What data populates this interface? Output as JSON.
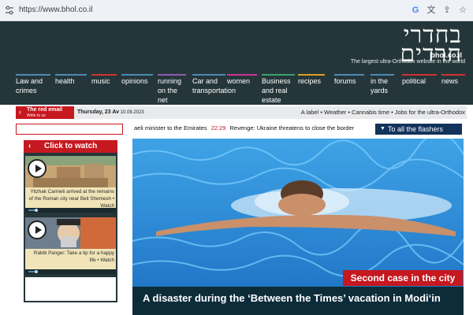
{
  "browser": {
    "url": "https://www.bhol.co.il",
    "icons": [
      "google-icon",
      "translate-icon",
      "share-icon",
      "bookmark-star-icon"
    ]
  },
  "header": {
    "logo_text": "בחדרי חרדים",
    "logo_domain": "bhol.co.il",
    "tagline": "The largest ultra-Orthodox website in the world"
  },
  "nav": {
    "items": [
      {
        "label": "Law and crimes"
      },
      {
        "label": "health"
      },
      {
        "label": "music"
      },
      {
        "label": "opinions"
      },
      {
        "label": "running on the net"
      },
      {
        "label": "Car and transportation"
      },
      {
        "label": "women"
      },
      {
        "label": "Business and real estate"
      },
      {
        "label": "recipes"
      },
      {
        "label": "forums"
      },
      {
        "label": "in the yards"
      },
      {
        "label": "political"
      },
      {
        "label": "news"
      }
    ]
  },
  "flash_row": {
    "email_title": "The red email",
    "email_sub": "Write to us",
    "date_day": "Thursday, 23 Av",
    "date_greg": "10.08.2023",
    "links": "A label • Weather • Cannabis time • Jobs for the ultra-Orthodox"
  },
  "ticker": {
    "left_text": "aeli minister to the Emirates",
    "time": "22:29",
    "right_text": "Revenge: Ukraine threatens to close the border"
  },
  "flashers_button": "To all the flashers",
  "video_panel": {
    "title": "Click to watch",
    "videos": [
      {
        "caption": "Yitzhak Carmeli arrived at the remains of the Roman city near Beit Shemesh • Watch",
        "progress": 0.1
      },
      {
        "caption": "Rabbi Panger: Take a tip for a happy life • Watch",
        "progress": 0.1
      }
    ]
  },
  "hero": {
    "badge": "Second case in the city",
    "title": "A disaster during the ‘Between the Times’ vacation in Modi‘in"
  },
  "colors": {
    "header_bg": "#25363a",
    "accent_red": "#c6181f",
    "nav_underline": "#4b8bb5",
    "flashers_blue": "#12335c"
  }
}
